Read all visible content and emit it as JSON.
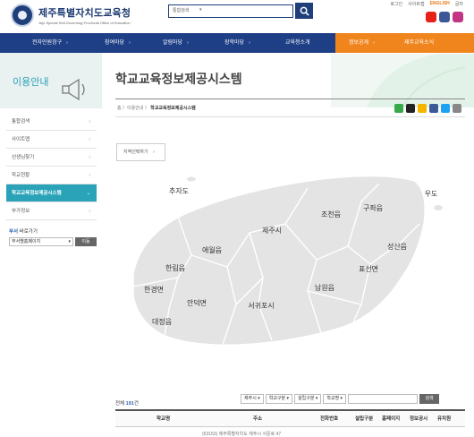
{
  "header": {
    "title": "제주특별자치도교육청",
    "subtitle": "Jeju Special Self-Governing Provincial Office of Education",
    "search_select": "통합검색",
    "util": [
      "로그인",
      "사이트맵",
      "ENGLISH",
      "글자"
    ],
    "sns": [
      "youtube-icon",
      "facebook-icon",
      "instagram-icon"
    ],
    "sns_colors": [
      "#e62117",
      "#3b5998",
      "#c13584"
    ]
  },
  "gnb": [
    "전자민원창구",
    "참여마당",
    "알림마당",
    "장학마당",
    "교육청소개",
    "정보공개",
    "제주교육소식"
  ],
  "sidebar": {
    "title": "이용안내",
    "items": [
      "통합검색",
      "사이트맵",
      "선생님찾기",
      "학교현황",
      "학교교육정보제공시스템",
      "부가정보"
    ],
    "quick_title_prefix": "부서",
    "quick_title": " 바로가기",
    "quick_select": "부서별홈페이지",
    "quick_btn": "이동"
  },
  "content": {
    "title": "학교교육정보제공시스템",
    "breadcrumb_path": "홈 〉이용안내 〉",
    "breadcrumb_current": "학교교육정보제공시스템",
    "share_colors": [
      "#3aa94a",
      "#222222",
      "#f4b400",
      "#3b5998",
      "#1da1f2",
      "#888888"
    ],
    "region_select": "지역선택하기"
  },
  "map": {
    "labels": [
      "추자도",
      "우도",
      "조천읍",
      "구좌읍",
      "제주시",
      "애월읍",
      "성산읍",
      "한림읍",
      "표선면",
      "남원읍",
      "한경면",
      "안덕면",
      "서귀포시",
      "대정읍"
    ]
  },
  "list": {
    "count_prefix": "전체 ",
    "count": "191",
    "count_suffix": "건",
    "filters": [
      "제주시",
      "학교구분",
      "설립구분",
      "학교명"
    ],
    "search_btn": "검색",
    "columns": [
      "학교명",
      "주소",
      "전화번호",
      "설립구분",
      "홈페이지",
      "정보공시",
      "유치원"
    ],
    "first_row": "(63153) 제주특별자치도 제주시 서문로 47"
  }
}
